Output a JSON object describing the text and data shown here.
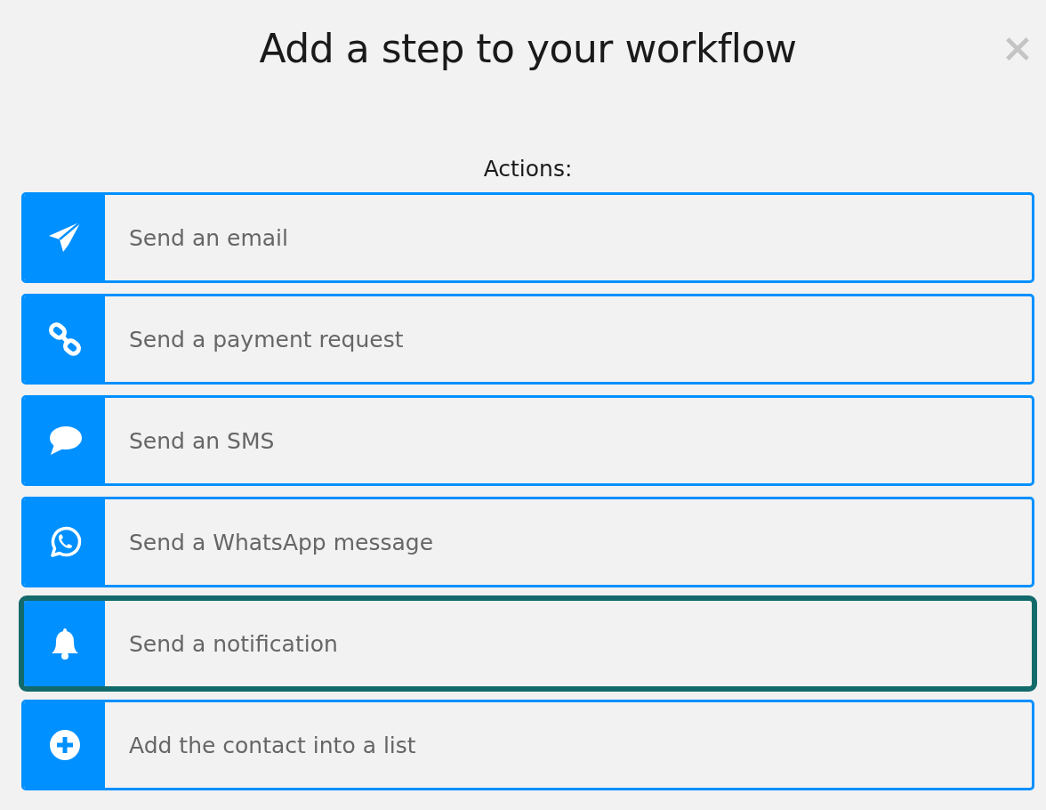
{
  "dialog": {
    "title": "Add a step to your workflow",
    "section_label": "Actions:"
  },
  "actions": [
    {
      "kind": "plane",
      "label": "Send an email",
      "focused": false
    },
    {
      "kind": "link",
      "label": "Send a payment request",
      "focused": false
    },
    {
      "kind": "chat",
      "label": "Send an SMS",
      "focused": false
    },
    {
      "kind": "whatsapp",
      "label": "Send a WhatsApp message",
      "focused": false
    },
    {
      "kind": "bell",
      "label": "Send a notification",
      "focused": true
    },
    {
      "kind": "plus",
      "label": "Add the contact into a list",
      "focused": false
    }
  ]
}
